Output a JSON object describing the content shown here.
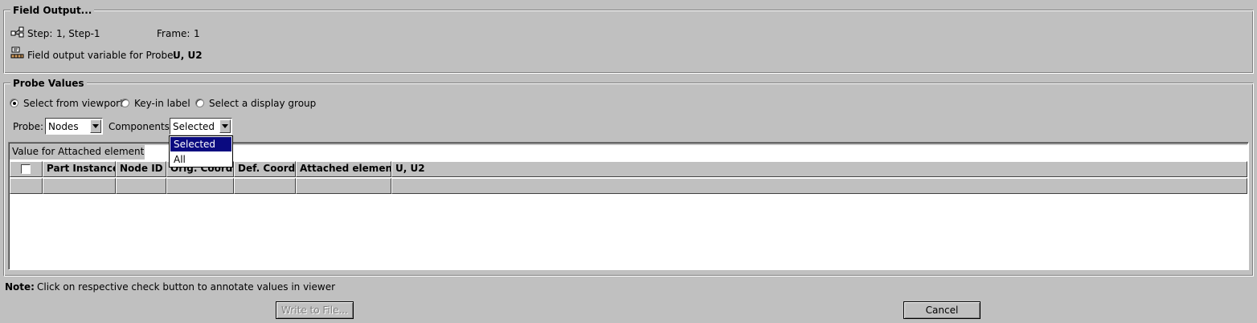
{
  "field_output": {
    "title": "Field Output...",
    "step_label": "Step:",
    "step_value": "1, Step-1",
    "frame_label": "Frame:",
    "frame_value": "1",
    "variable_label": "Field output variable for Probe:",
    "variable_value": "U, U2"
  },
  "probe_values": {
    "title": "Probe Values",
    "radios": [
      {
        "label": "Select from viewport",
        "selected": true
      },
      {
        "label": "Key-in label",
        "selected": false
      },
      {
        "label": "Select a display group",
        "selected": false
      }
    ],
    "probe_label": "Probe:",
    "probe_value": "Nodes",
    "components_label": "Components:",
    "components_value": "Selected",
    "components_options": [
      "Selected",
      "All"
    ],
    "value_for_label": "Value for Attached elements:",
    "value_for_value": "",
    "columns": [
      "",
      "Part Instance",
      "Node ID",
      "Orig. Coords",
      "Def. Coords",
      "Attached elements",
      "U, U2"
    ]
  },
  "note": {
    "label": "Note:",
    "text": "Click on respective check button to annotate values in viewer"
  },
  "buttons": {
    "write_to_file": "Write to File...",
    "cancel": "Cancel"
  },
  "colors": {
    "background": "#c0c0c0",
    "selection": "#0a0a80"
  }
}
